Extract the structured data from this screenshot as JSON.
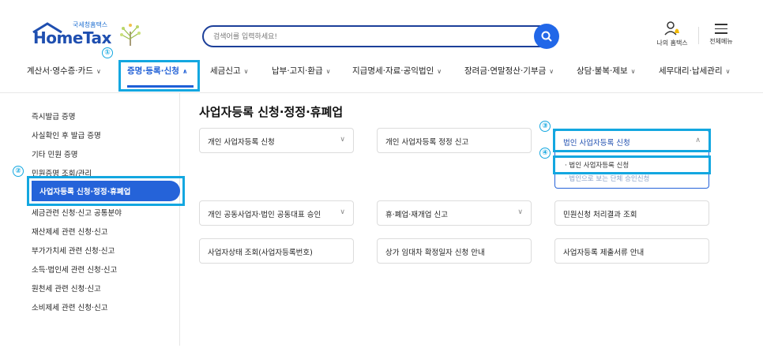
{
  "header": {
    "logo_small": "국세청홈택스",
    "logo_main": "HomeTax",
    "search_placeholder": "검색어를 입력하세요!",
    "my_hometax": "나의 홈택스",
    "all_menu": "전체메뉴"
  },
  "nav": {
    "items": [
      {
        "label": "계산서·영수증·카드"
      },
      {
        "label": "증명·등록·신청"
      },
      {
        "label": "세금신고"
      },
      {
        "label": "납부·고지·환급"
      },
      {
        "label": "지급명세·자료·공익법인"
      },
      {
        "label": "장려금·연말정산·기부금"
      },
      {
        "label": "상담·불복·제보"
      },
      {
        "label": "세무대리·납세관리"
      }
    ]
  },
  "sidebar": {
    "items": [
      {
        "label": "즉시발급 증명"
      },
      {
        "label": "사실확인 후 발급 증명"
      },
      {
        "label": "기타 민원 증명"
      },
      {
        "label": "민원증명 조회/관리"
      },
      {
        "label": "사업자등록 신청·정정·휴폐업"
      },
      {
        "label": "세금관련 신청·신고 공통분야"
      },
      {
        "label": "재산제세 관련 신청·신고"
      },
      {
        "label": "부가가치세 관련 신청·신고"
      },
      {
        "label": "소득·법인세 관련 신청·신고"
      },
      {
        "label": "원천세 관련 신청·신고"
      },
      {
        "label": "소비제세 관련 신청·신고"
      }
    ]
  },
  "main": {
    "title": "사업자등록 신청·정정·휴폐업",
    "cards": [
      {
        "label": "개인 사업자등록 신청"
      },
      {
        "label": "개인 사업자등록 정정 신고"
      },
      {
        "label": "법인 사업자등록 신청"
      },
      {
        "label": "개인 공동사업자·법인 공동대표 승인"
      },
      {
        "label": "휴·폐업·재개업 신고"
      },
      {
        "label": "민원신청 처리결과 조회"
      },
      {
        "label": "사업자상태 조회(사업자등록번호)"
      },
      {
        "label": "상가 임대차 확정일자 신청 안내"
      },
      {
        "label": "사업자등록 제출서류 안내"
      }
    ],
    "dropdown": [
      {
        "label": "· 법인 사업자등록 신청"
      },
      {
        "label": "· 법인으로 보는 단체 승인신청"
      }
    ]
  },
  "annotations": {
    "badge1": "①",
    "badge2": "②",
    "badge3": "③",
    "badge4": "④"
  },
  "colors": {
    "accent": "#2563d9",
    "highlight": "#13a7e0"
  }
}
